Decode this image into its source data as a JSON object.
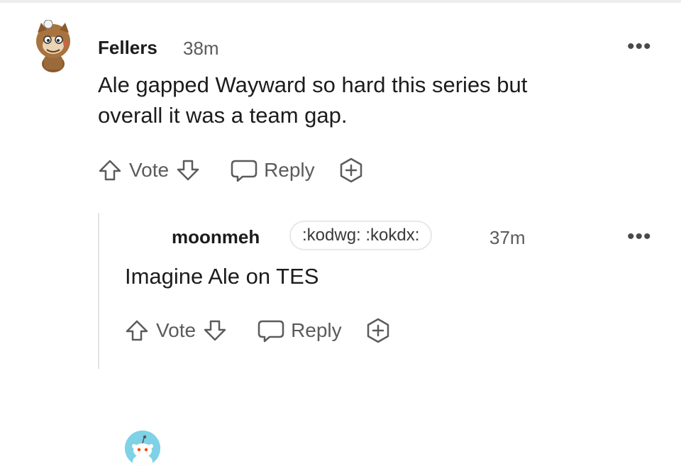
{
  "comments": [
    {
      "author": "Fellers",
      "time": "38m",
      "body_lines": [
        "Ale gapped Wayward so hard this series but",
        "overall it was a team gap."
      ],
      "actions": {
        "vote": "Vote",
        "reply": "Reply"
      }
    },
    {
      "author": "moonmeh",
      "flair": ":kodwg: :kokdx:",
      "time": "37m",
      "body_lines": [
        "Imagine Ale on TES"
      ],
      "actions": {
        "vote": "Vote",
        "reply": "Reply"
      }
    }
  ],
  "icons": {
    "upvote": "arrow-up-icon",
    "downvote": "arrow-down-icon",
    "reply": "speech-bubble-icon",
    "award": "plus-award-icon",
    "more": "more-options-icon"
  },
  "colors": {
    "text": "#1c1c1c",
    "muted": "#5b5b5b",
    "avatar_bg": "#7fd1e6"
  }
}
